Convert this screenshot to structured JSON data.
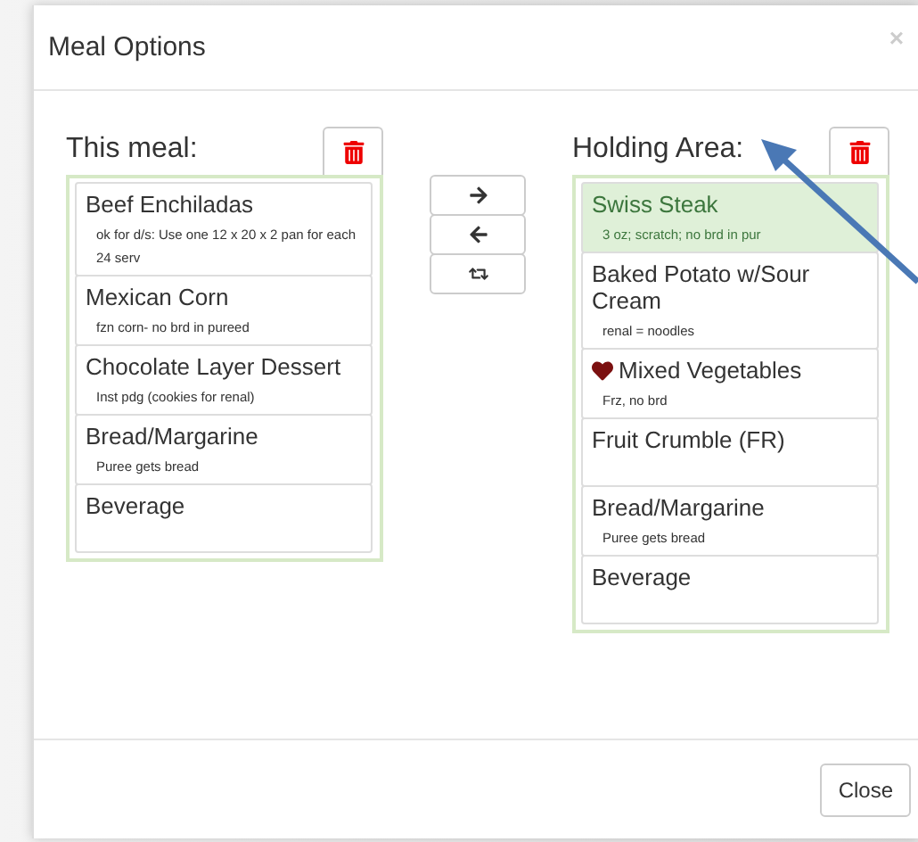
{
  "dialog": {
    "title": "Meal Options",
    "close_symbol": "×"
  },
  "this_meal": {
    "heading": "This meal:",
    "items": [
      {
        "name": "Beef Enchiladas",
        "note": "ok for d/s: Use one 12 x 20 x 2 pan for each 24 serv",
        "selected": false
      },
      {
        "name": "Mexican Corn",
        "note": "fzn corn- no brd in pureed",
        "selected": false
      },
      {
        "name": "Chocolate Layer Dessert",
        "note": "Inst pdg (cookies for renal)",
        "selected": false
      },
      {
        "name": "Bread/Margarine",
        "note": "Puree gets bread",
        "selected": false
      },
      {
        "name": "Beverage",
        "selected": false
      }
    ]
  },
  "holding_area": {
    "heading": "Holding Area:",
    "items": [
      {
        "name": "Swiss Steak",
        "note": "3 oz; scratch; no brd in pur",
        "selected": true,
        "favorite": false
      },
      {
        "name": "Baked Potato w/Sour Cream",
        "note": "renal = noodles",
        "selected": false,
        "favorite": false
      },
      {
        "name": "Mixed Vegetables",
        "note": "Frz, no brd",
        "selected": false,
        "favorite": true
      },
      {
        "name": "Fruit Crumble (FR)",
        "selected": false,
        "favorite": false
      },
      {
        "name": "Bread/Margarine",
        "note": "Puree gets bread",
        "selected": false,
        "favorite": false
      },
      {
        "name": "Beverage",
        "selected": false,
        "favorite": false
      }
    ]
  },
  "move_buttons": [
    {
      "kind": "right"
    },
    {
      "kind": "left"
    },
    {
      "kind": "swap"
    }
  ],
  "footer": {
    "button": "Close"
  }
}
